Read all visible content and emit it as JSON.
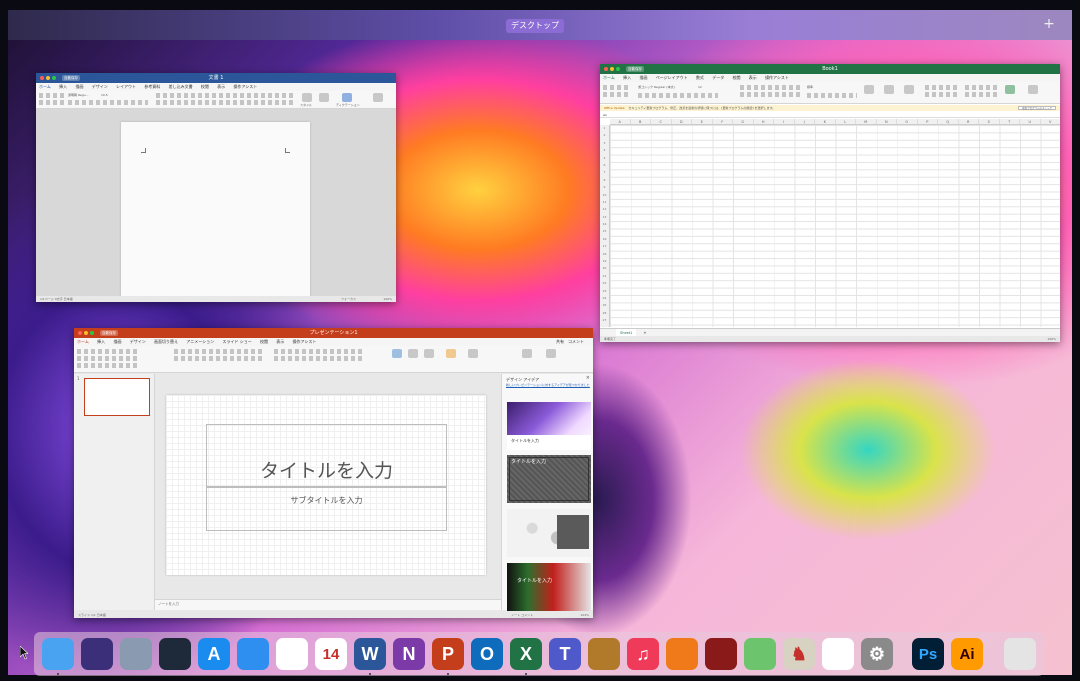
{
  "mission_control": {
    "desktop_label": "デスクトップ",
    "add_label": "+"
  },
  "word": {
    "title": "文書 1",
    "autosave": "自動保存",
    "tabs": [
      "ホーム",
      "挿入",
      "描画",
      "デザイン",
      "レイアウト",
      "参考資料",
      "差し込み文書",
      "校閲",
      "表示",
      "操作アシスト"
    ],
    "font_name": "游明朝 Regu...",
    "font_size": "10.5",
    "ribbon_labels": [
      "スタイル",
      "スタイル ウィンドウ",
      "ディクテーション",
      "ロカ..."
    ],
    "status": "1/1ページ  0文字  日本語",
    "status_right": "フォーカス",
    "zoom": "100%"
  },
  "excel": {
    "title": "Book1",
    "autosave": "自動保存",
    "tabs": [
      "ホーム",
      "挿入",
      "描画",
      "ページレイアウト",
      "数式",
      "データ",
      "校閲",
      "表示",
      "操作アシスト"
    ],
    "font_name": "游ゴシック Regular (本文)",
    "font_size": "12",
    "number_format": "標準",
    "message_label": "Office Update",
    "message": "セキュリティ更新プログラム、修正、改善を最新の状態に保つには、[更新プログラムの確認] を選択します。",
    "message_button": "更新プログラムのチェック",
    "name_box": "A1",
    "columns": [
      "A",
      "B",
      "C",
      "D",
      "E",
      "F",
      "G",
      "H",
      "I",
      "J",
      "K",
      "L",
      "M",
      "N",
      "O",
      "P",
      "Q",
      "R",
      "S",
      "T",
      "U",
      "V",
      "W"
    ],
    "rows": [
      "1",
      "2",
      "3",
      "4",
      "5",
      "6",
      "7",
      "8",
      "9",
      "10",
      "11",
      "12",
      "13",
      "14",
      "15",
      "16",
      "17",
      "18",
      "19",
      "20",
      "21",
      "22",
      "23",
      "24",
      "25",
      "26",
      "27"
    ],
    "sheet_tab": "Sheet1",
    "add_sheet": "+",
    "status": "準備完了",
    "zoom": "100%"
  },
  "powerpoint": {
    "title": "プレゼンテーション1",
    "autosave": "自動保存",
    "tabs": [
      "ホーム",
      "挿入",
      "描画",
      "デザイン",
      "画面切り替え",
      "アニメーション",
      "スライド ショー",
      "校閲",
      "表示",
      "操作アシスト"
    ],
    "slide_number": "1",
    "slide_title": "タイトルを入力",
    "slide_subtitle": "サブタイトルを入力",
    "notes_placeholder": "ノートを入力",
    "designer_title": "デザイン アイデア",
    "designer_desc": "新しいプレゼンテーションに対するアイデアが見つかりました",
    "card_texts": [
      "タイトルを入力",
      "タイトルを入力",
      "タイトルを入力"
    ],
    "status": "スライド 1/1  日本語",
    "status_right": "ノート  コメント",
    "zoom": "104%",
    "share_label": "共有",
    "comment_label": "コメント"
  },
  "dock": {
    "items": [
      {
        "name": "finder-icon",
        "glyph": "",
        "bg": "#4aa3f0",
        "running": true
      },
      {
        "name": "siri-icon",
        "glyph": "",
        "bg": "#3b2f7a",
        "running": false
      },
      {
        "name": "launchpad-icon",
        "glyph": "",
        "bg": "#8a9ab0",
        "running": false
      },
      {
        "name": "mission-control-icon",
        "glyph": "",
        "bg": "#1e2a3a",
        "running": false
      },
      {
        "name": "app-store-icon",
        "glyph": "A",
        "bg": "#1a8cf0",
        "running": false
      },
      {
        "name": "safari-icon",
        "glyph": "",
        "bg": "#2e8ff0",
        "running": false
      },
      {
        "name": "chrome-icon",
        "glyph": "",
        "bg": "#ffffff",
        "running": false
      },
      {
        "name": "calendar-icon",
        "glyph": "14",
        "bg": "#ffffff",
        "running": false
      },
      {
        "name": "word-icon",
        "glyph": "W",
        "bg": "#2b579a",
        "running": true
      },
      {
        "name": "onenote-icon",
        "glyph": "N",
        "bg": "#7b3aa8",
        "running": false
      },
      {
        "name": "powerpoint-icon",
        "glyph": "P",
        "bg": "#c43e1c",
        "running": true
      },
      {
        "name": "outlook-icon",
        "glyph": "O",
        "bg": "#0f6cbd",
        "running": false
      },
      {
        "name": "excel-icon",
        "glyph": "X",
        "bg": "#217346",
        "running": true
      },
      {
        "name": "teams-icon",
        "glyph": "T",
        "bg": "#5059c9",
        "running": false
      },
      {
        "name": "notebook-icon",
        "glyph": "",
        "bg": "#b07a2a",
        "running": false
      },
      {
        "name": "music-icon",
        "glyph": "♫",
        "bg": "#f03a5a",
        "running": false
      },
      {
        "name": "books-icon",
        "glyph": "",
        "bg": "#f07a1a",
        "running": false
      },
      {
        "name": "photo-booth-icon",
        "glyph": "",
        "bg": "#8a1a1a",
        "running": false
      },
      {
        "name": "maps-icon",
        "glyph": "",
        "bg": "#6cc46c",
        "running": false
      },
      {
        "name": "chess-icon",
        "glyph": "♞",
        "bg": "#d8d2c2",
        "running": false
      },
      {
        "name": "photos-icon",
        "glyph": "",
        "bg": "#ffffff",
        "running": false
      },
      {
        "name": "system-preferences-icon",
        "glyph": "⚙",
        "bg": "#8a8a8a",
        "running": false
      },
      {
        "name": "photoshop-icon",
        "glyph": "Ps",
        "bg": "#001e36",
        "running": false
      },
      {
        "name": "illustrator-icon",
        "glyph": "Ai",
        "bg": "#ff9a00",
        "running": false
      },
      {
        "name": "trash-icon",
        "glyph": "",
        "bg": "#e4e4e4",
        "running": false
      }
    ]
  },
  "colors": {
    "word": "#2b579a",
    "excel": "#217346",
    "powerpoint": "#c43e1c"
  }
}
